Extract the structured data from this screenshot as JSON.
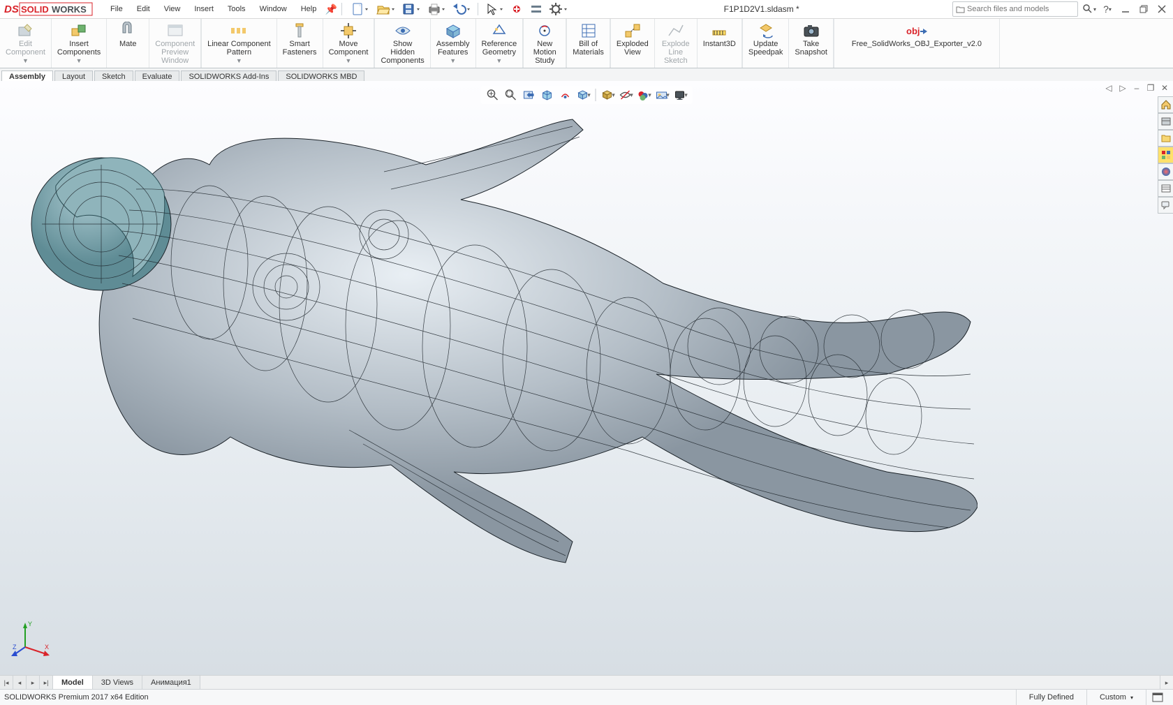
{
  "app": {
    "title": "F1P1D2V1.sldasm *"
  },
  "menu": {
    "items": [
      "File",
      "Edit",
      "View",
      "Insert",
      "Tools",
      "Window",
      "Help"
    ]
  },
  "search": {
    "placeholder": "Search files and models"
  },
  "ribbon": {
    "edit_component": "Edit\nComponent",
    "insert_components": "Insert\nComponents",
    "mate": "Mate",
    "component_preview": "Component\nPreview\nWindow",
    "linear_pattern": "Linear Component\nPattern",
    "smart_fasteners": "Smart\nFasteners",
    "move_component": "Move\nComponent",
    "show_hidden": "Show\nHidden\nComponents",
    "assembly_features": "Assembly\nFeatures",
    "reference_geometry": "Reference\nGeometry",
    "new_motion": "New\nMotion\nStudy",
    "bom": "Bill of\nMaterials",
    "exploded_view": "Exploded\nView",
    "explode_line": "Explode\nLine\nSketch",
    "instant3d": "Instant3D",
    "update_speedpak": "Update\nSpeedpak",
    "take_snapshot": "Take\nSnapshot",
    "obj_exporter": "Free_SolidWorks_OBJ_Exporter_v2.0"
  },
  "cmtabs": [
    "Assembly",
    "Layout",
    "Sketch",
    "Evaluate",
    "SOLIDWORKS Add-Ins",
    "SOLIDWORKS MBD"
  ],
  "bottom": {
    "tabs": [
      "Model",
      "3D Views",
      "Анимация1"
    ]
  },
  "status": {
    "edition": "SOLIDWORKS Premium 2017 x64 Edition",
    "defined": "Fully Defined",
    "units": "Custom"
  }
}
